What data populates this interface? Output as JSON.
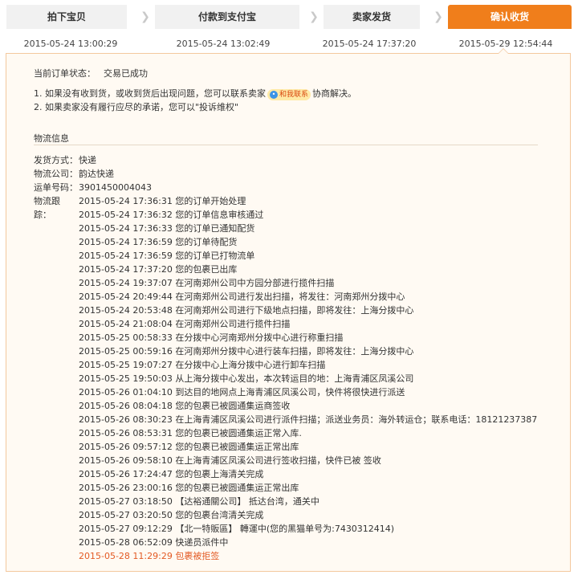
{
  "steps": [
    {
      "label": "拍下宝贝",
      "time": "2015-05-24 13:00:29",
      "active": false
    },
    {
      "label": "付款到支付宝",
      "time": "2015-05-24 13:02:49",
      "active": false
    },
    {
      "label": "卖家发货",
      "time": "2015-05-24 17:37:20",
      "active": false
    },
    {
      "label": "确认收货",
      "time": "2015-05-29 12:54:44",
      "active": true
    }
  ],
  "order_status": {
    "label": "当前订单状态：",
    "value": "交易已成功"
  },
  "notes": {
    "line1_prefix": "1. 如果没有收到货，或收到货后出现问题，您可以联系卖家",
    "seller_badge": "和我联系",
    "line1_suffix": "协商解决。",
    "line2": "2. 如果卖家没有履行应尽的承诺，您可以\"投诉维权\""
  },
  "logistics": {
    "title": "物流信息",
    "fields": [
      {
        "label": "发货方式：",
        "value": "快递"
      },
      {
        "label": "物流公司：",
        "value": "韵达快递"
      },
      {
        "label": "运单号码：",
        "value": "3901450004043"
      }
    ],
    "tracking_label": "物流跟踪：",
    "tracking": [
      {
        "text": "2015-05-24 17:36:31 您的订单开始处理",
        "highlight": false
      },
      {
        "text": "2015-05-24 17:36:32 您的订单信息审核通过",
        "highlight": false
      },
      {
        "text": "2015-05-24 17:36:33 您的订单已通知配货",
        "highlight": false
      },
      {
        "text": "2015-05-24 17:36:59 您的订单待配货",
        "highlight": false
      },
      {
        "text": "2015-05-24 17:36:59 您的订单已打物流单",
        "highlight": false
      },
      {
        "text": "2015-05-24 17:37:20 您的包裹已出库",
        "highlight": false
      },
      {
        "text": "2015-05-24 19:37:07 在河南郑州公司中方园分部进行揽件扫描",
        "highlight": false
      },
      {
        "text": "2015-05-24 20:49:44 在河南郑州公司进行发出扫描，将发往：河南郑州分拨中心",
        "highlight": false
      },
      {
        "text": "2015-05-24 20:53:48 在河南郑州公司进行下级地点扫描，即将发往：上海分拨中心",
        "highlight": false
      },
      {
        "text": "2015-05-24 21:08:04 在河南郑州公司进行揽件扫描",
        "highlight": false
      },
      {
        "text": "2015-05-25 00:58:33 在分拨中心河南郑州分拨中心进行称重扫描",
        "highlight": false
      },
      {
        "text": "2015-05-25 00:59:16 在河南郑州分拨中心进行装车扫描，即将发往：上海分拨中心",
        "highlight": false
      },
      {
        "text": "2015-05-25 19:07:27 在分拨中心上海分拨中心进行卸车扫描",
        "highlight": false
      },
      {
        "text": "2015-05-25 19:50:03 从上海分拨中心发出，本次转运目的地：上海青浦区凤溪公司",
        "highlight": false
      },
      {
        "text": "2015-05-26 01:04:10 到达目的地网点上海青浦区凤溪公司，快件将很快进行派送",
        "highlight": false
      },
      {
        "text": "2015-05-26 08:04:18 您的包裹已被圆通集运商签收",
        "highlight": false
      },
      {
        "text": "2015-05-26 08:30:23 在上海青浦区凤溪公司进行派件扫描；派送业务员：海外转运仓；联系电话：18121237387",
        "highlight": false
      },
      {
        "text": "2015-05-26 08:53:31 您的包裹已被圆通集运正常入库.",
        "highlight": false
      },
      {
        "text": "2015-05-26 09:57:12 您的包裹已被圆通集运正常出库",
        "highlight": false
      },
      {
        "text": "2015-05-26 09:58:10 在上海青浦区凤溪公司进行签收扫描，快件已被 签收",
        "highlight": false
      },
      {
        "text": "2015-05-26 17:24:47 您的包裹上海清关完成",
        "highlight": false
      },
      {
        "text": "2015-05-26 23:00:16 您的包裹已被圆通集运正常出库",
        "highlight": false
      },
      {
        "text": "2015-05-27 03:18:50 【达裕通關公司】 抵达台湾，通关中",
        "highlight": false
      },
      {
        "text": "2015-05-27 03:20:50 您的包裹台湾清关完成",
        "highlight": false
      },
      {
        "text": "2015-05-27 09:12:29 【北一特販區】 轉運中(您的黑猫单号为:7430312414)",
        "highlight": false
      },
      {
        "text": "2015-05-28 06:52:09 快递员派件中",
        "highlight": false
      },
      {
        "text": "2015-05-28 11:29:29 包裹被拒签",
        "highlight": true
      }
    ]
  },
  "colors": {
    "accent": "#f07e1b",
    "warn": "#e35a24",
    "panel_bg": "#fffaf3",
    "panel_border": "#f3c89e"
  }
}
